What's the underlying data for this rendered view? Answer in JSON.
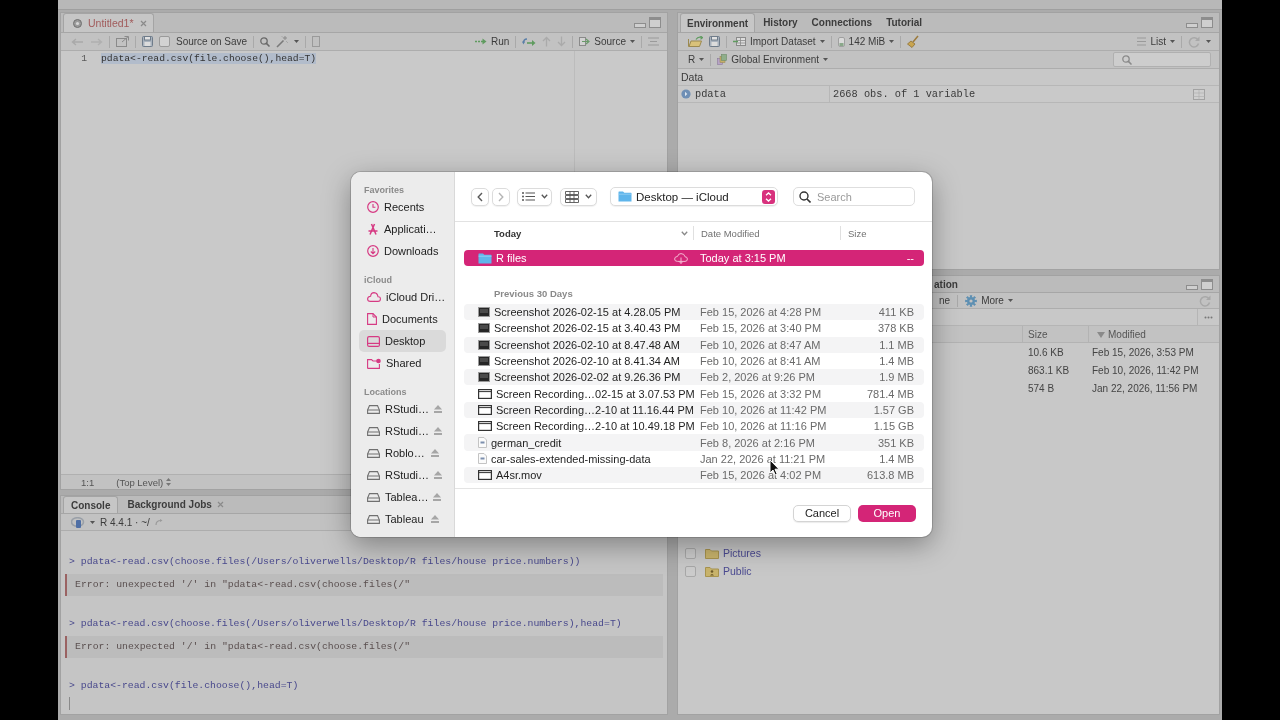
{
  "editor": {
    "tabs": [
      {
        "label": "Untitled1*",
        "selected": true
      }
    ],
    "toolbar": {
      "source_on_save": {
        "label": "Source on Save",
        "checked": false
      },
      "run": "Run",
      "source": "Source"
    },
    "lines": [
      {
        "number": "1",
        "code": "pdata<-read.csv(file.choose(),head=T)",
        "selected": true
      }
    ],
    "status_bar": {
      "position": "1:1",
      "scope": "(Top Level)"
    }
  },
  "console": {
    "tabs": [
      {
        "label": "Console",
        "selected": true,
        "closable": false
      },
      {
        "label": "Background Jobs",
        "selected": false,
        "closable": true
      }
    ],
    "version": "R 4.4.1 · ~/",
    "lines": [
      {
        "kind": "input",
        "text": "> pdata<-read.csv(choose.files(/Users/oliverwells/Desktop/R files/house price.numbers))"
      },
      {
        "kind": "error",
        "text": "Error: unexpected '/' in \"pdata<-read.csv(choose.files(/\""
      },
      {
        "kind": "input",
        "text": "> pdata<-read.csv(choose.files(/Users/oliverwells/Desktop/R files/house price.numbers),head=T)"
      },
      {
        "kind": "error",
        "text": "Error: unexpected '/' in \"pdata<-read.csv(choose.files(/\""
      },
      {
        "kind": "input",
        "text": "> pdata<-read.csv(file.choose(),head=T)"
      }
    ]
  },
  "environment": {
    "tabs": [
      {
        "label": "Environment",
        "selected": true
      },
      {
        "label": "History",
        "selected": false
      },
      {
        "label": "Connections",
        "selected": false
      },
      {
        "label": "Tutorial",
        "selected": false
      }
    ],
    "toolbar": {
      "import_dataset": "Import Dataset",
      "memory": "142 MiB",
      "view": "List"
    },
    "language": "R",
    "scope": "Global Environment",
    "section": "Data",
    "rows": [
      {
        "name": "pdata",
        "value": "2668 obs. of 1 variable"
      }
    ]
  },
  "files": {
    "tabs": [
      {
        "label": "ation"
      }
    ],
    "toolbar": [
      {
        "label": "ne",
        "kind": "plain"
      },
      {
        "label": "More",
        "kind": "menu"
      }
    ],
    "columns": [
      {
        "label": "Size",
        "sorted": false
      },
      {
        "label": "Modified",
        "sorted": true
      }
    ],
    "rows": [
      {
        "size": "10.6 KB",
        "modified": "Feb 15, 2026, 3:53 PM"
      },
      {
        "size": "863.1 KB",
        "modified": "Feb 10, 2026, 11:42 PM"
      },
      {
        "size": "574 B",
        "modified": "Jan 22, 2026, 11:56 PM"
      }
    ],
    "folders": [
      {
        "name": "Pictures",
        "kind": "folder",
        "checked": false
      },
      {
        "name": "Public",
        "kind": "public",
        "checked": false
      }
    ]
  },
  "open_dialog": {
    "sidebar": [
      {
        "heading": "Favorites",
        "items": [
          {
            "label": "Recents",
            "kind": "clock",
            "selected": false,
            "ejectable": false
          },
          {
            "label": "Applicati…",
            "kind": "apps",
            "selected": false,
            "ejectable": false
          },
          {
            "label": "Downloads",
            "kind": "download",
            "selected": false,
            "ejectable": false
          }
        ]
      },
      {
        "heading": "iCloud",
        "items": [
          {
            "label": "iCloud Dri…",
            "kind": "cloud",
            "selected": false,
            "ejectable": false
          },
          {
            "label": "Documents",
            "kind": "document",
            "selected": false,
            "ejectable": false
          },
          {
            "label": "Desktop",
            "kind": "desktop",
            "selected": true,
            "ejectable": false
          },
          {
            "label": "Shared",
            "kind": "shared",
            "selected": false,
            "ejectable": false
          }
        ]
      },
      {
        "heading": "Locations",
        "items": [
          {
            "label": "RStudi…",
            "kind": "drive",
            "selected": false,
            "ejectable": true
          },
          {
            "label": "RStudi…",
            "kind": "drive",
            "selected": false,
            "ejectable": true
          },
          {
            "label": "Roblo…",
            "kind": "drive",
            "selected": false,
            "ejectable": true
          },
          {
            "label": "RStudi…",
            "kind": "drive",
            "selected": false,
            "ejectable": true
          },
          {
            "label": "Tablea…",
            "kind": "drive",
            "selected": false,
            "ejectable": true
          },
          {
            "label": "Tableau",
            "kind": "drive",
            "selected": false,
            "ejectable": true
          }
        ]
      }
    ],
    "location": "Desktop — iCloud",
    "search": {
      "placeholder": "Search"
    },
    "columns": [
      {
        "label": "Today"
      },
      {
        "label": "Date Modified"
      },
      {
        "label": "Size"
      }
    ],
    "groups": [
      {
        "items": [
          {
            "name": "R files",
            "kind": "folder",
            "in_cloud": true,
            "modified": "Today at 3:15 PM",
            "size": "--",
            "selected": true
          }
        ]
      },
      {
        "heading": "Previous 30 Days",
        "items": [
          {
            "name": "Screenshot 2026-02-15 at 4.28.05 PM",
            "kind": "image",
            "in_cloud": false,
            "modified": "Feb 15, 2026 at 4:28 PM",
            "size": "411 KB",
            "selected": false
          },
          {
            "name": "Screenshot 2026-02-15 at 3.40.43 PM",
            "kind": "image",
            "in_cloud": false,
            "modified": "Feb 15, 2026 at 3:40 PM",
            "size": "378 KB",
            "selected": false
          },
          {
            "name": "Screenshot 2026-02-10 at 8.47.48 AM",
            "kind": "image",
            "in_cloud": false,
            "modified": "Feb 10, 2026 at 8:47 AM",
            "size": "1.1 MB",
            "selected": false
          },
          {
            "name": "Screenshot 2026-02-10 at 8.41.34 AM",
            "kind": "image",
            "in_cloud": false,
            "modified": "Feb 10, 2026 at 8:41 AM",
            "size": "1.4 MB",
            "selected": false
          },
          {
            "name": "Screenshot 2026-02-02 at 9.26.36 PM",
            "kind": "image",
            "in_cloud": false,
            "modified": "Feb 2, 2026 at 9:26 PM",
            "size": "1.9 MB",
            "selected": false
          },
          {
            "name": "Screen Recording…02-15 at 3.07.53 PM",
            "kind": "video",
            "in_cloud": false,
            "modified": "Feb 15, 2026 at 3:32 PM",
            "size": "781.4 MB",
            "selected": false
          },
          {
            "name": "Screen Recording…2-10 at 11.16.44 PM",
            "kind": "video",
            "in_cloud": false,
            "modified": "Feb 10, 2026 at 11:42 PM",
            "size": "1.57 GB",
            "selected": false
          },
          {
            "name": "Screen Recording…2-10 at 10.49.18 PM",
            "kind": "video",
            "in_cloud": false,
            "modified": "Feb 10, 2026 at 11:16 PM",
            "size": "1.15 GB",
            "selected": false
          },
          {
            "name": "german_credit",
            "kind": "document",
            "in_cloud": false,
            "modified": "Feb 8, 2026 at 2:16 PM",
            "size": "351 KB",
            "selected": false
          },
          {
            "name": "car-sales-extended-missing-data",
            "kind": "document",
            "in_cloud": false,
            "modified": "Jan 22, 2026 at 11:21 PM",
            "size": "1.4 MB",
            "selected": false
          },
          {
            "name": "A4sr.mov",
            "kind": "video",
            "in_cloud": false,
            "modified": "Feb 15, 2026 at 4:02 PM",
            "size": "613.8 MB",
            "selected": false
          }
        ]
      }
    ],
    "buttons": [
      {
        "label": "Cancel",
        "kind": "secondary"
      },
      {
        "label": "Open",
        "kind": "primary"
      }
    ]
  }
}
